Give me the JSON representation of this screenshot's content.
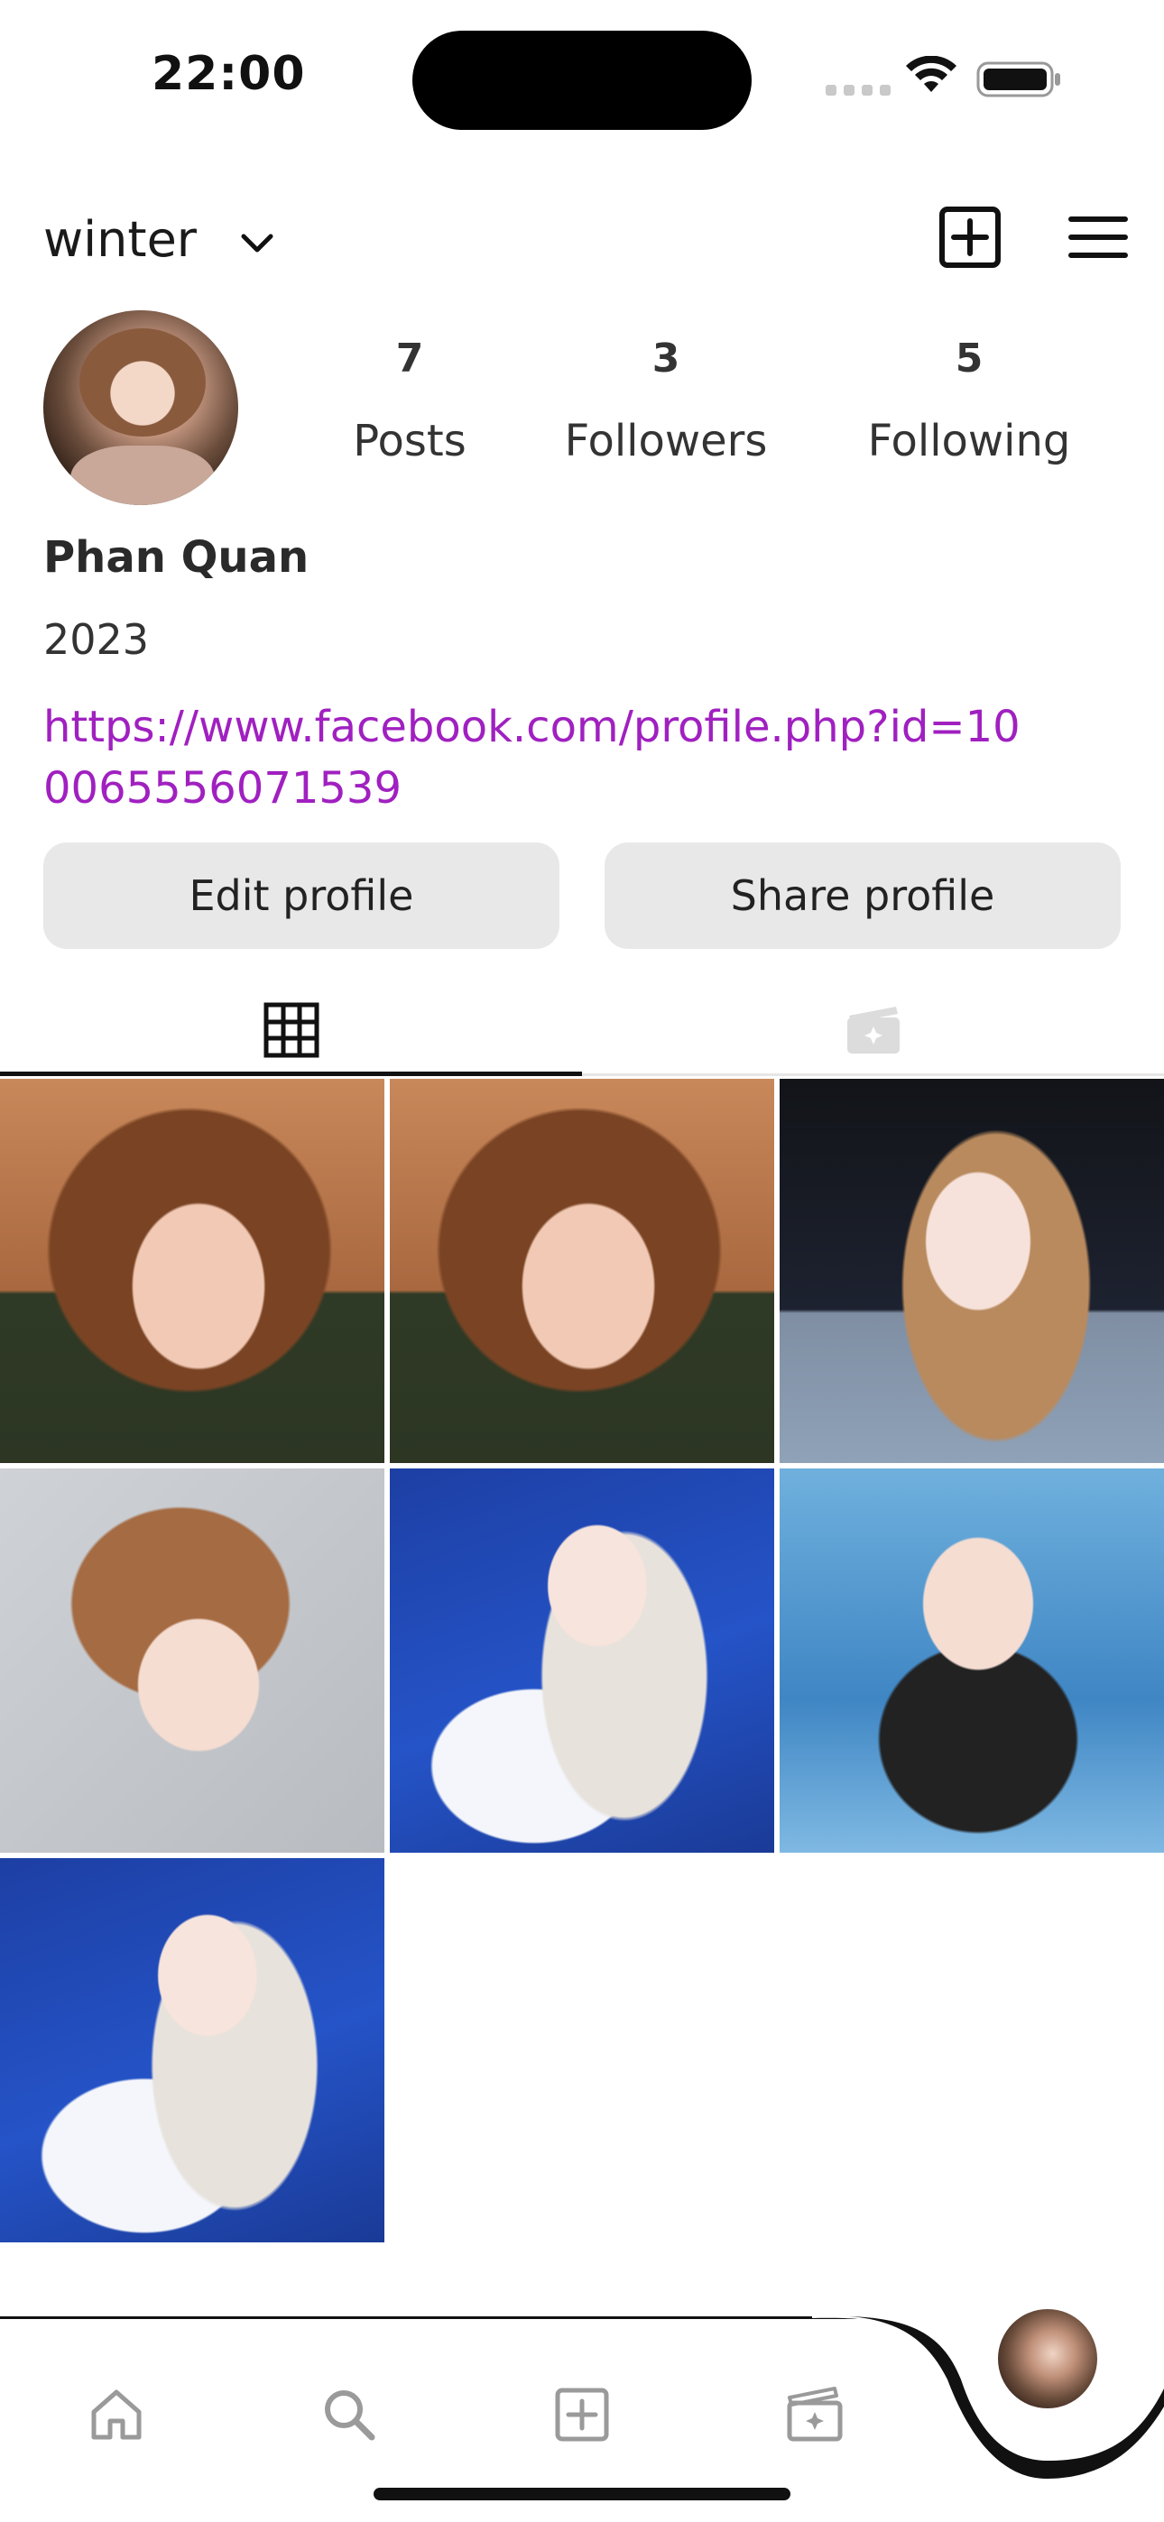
{
  "status_bar": {
    "time": "22:00"
  },
  "header": {
    "username": "winter"
  },
  "profile": {
    "stats": [
      {
        "count": "7",
        "label": "Posts"
      },
      {
        "count": "3",
        "label": "Followers"
      },
      {
        "count": "5",
        "label": "Following"
      }
    ],
    "display_name": "Phan Quan",
    "bio": "2023",
    "link": "https://www.facebook.com/profile.php?id=100065556071539"
  },
  "actions": {
    "edit_label": "Edit profile",
    "share_label": "Share profile"
  },
  "tabs": [
    {
      "icon": "grid-icon",
      "active": true
    },
    {
      "icon": "reels-icon",
      "active": false
    }
  ],
  "posts_count": 7,
  "bottom_nav": [
    {
      "icon": "home-icon"
    },
    {
      "icon": "search-icon"
    },
    {
      "icon": "add-post-icon"
    },
    {
      "icon": "reels-icon"
    },
    {
      "icon": "profile-avatar-icon"
    }
  ],
  "colors": {
    "link": "#a020c0",
    "button_bg": "#e8e8e8",
    "text": "#222222"
  }
}
